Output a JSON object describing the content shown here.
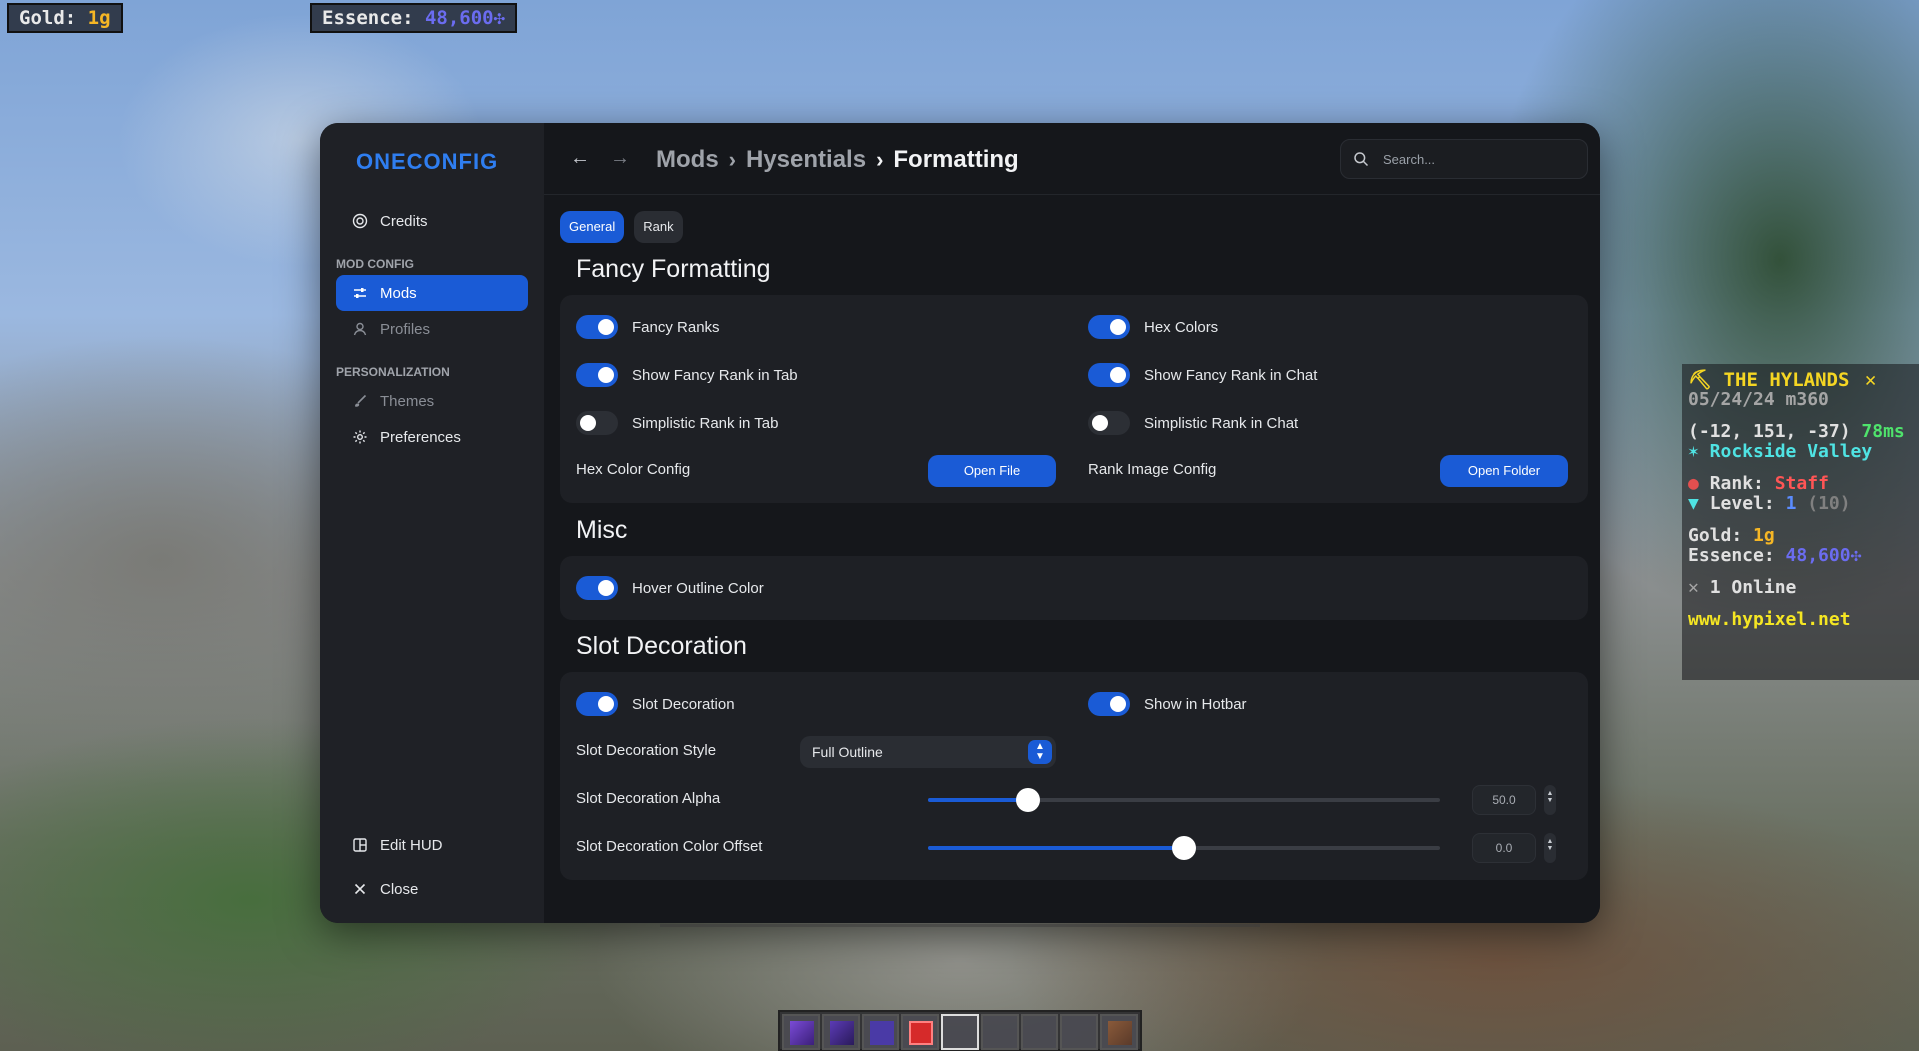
{
  "hud": {
    "gold_label": "Gold:",
    "gold_value": "1g",
    "essence_label": "Essence:",
    "essence_value": "48,600✣"
  },
  "app": {
    "logo": "ONECONFIG"
  },
  "sidebar": {
    "credits": "Credits",
    "mod_config_heading": "MOD CONFIG",
    "mods": "Mods",
    "profiles": "Profiles",
    "personalization_heading": "PERSONALIZATION",
    "themes": "Themes",
    "preferences": "Preferences",
    "edit_hud": "Edit HUD",
    "close": "Close"
  },
  "topbar": {
    "back": "←",
    "forward": "→",
    "breadcrumb": [
      "Mods",
      "Hysentials",
      "Formatting"
    ],
    "search_placeholder": "Search..."
  },
  "tabs": [
    "General",
    "Rank"
  ],
  "fancy_formatting": {
    "title": "Fancy Formatting",
    "fancy_ranks": "Fancy Ranks",
    "hex_colors": "Hex Colors",
    "show_fancy_rank_tab": "Show Fancy Rank in Tab",
    "show_fancy_rank_chat": "Show Fancy Rank in Chat",
    "simplistic_rank_tab": "Simplistic Rank in Tab",
    "simplistic_rank_chat": "Simplistic Rank in Chat",
    "hex_color_config": "Hex Color Config",
    "open_file": "Open File",
    "rank_image_config": "Rank Image Config",
    "open_folder": "Open Folder"
  },
  "misc": {
    "title": "Misc",
    "hover_outline_color": "Hover Outline Color"
  },
  "slot_decoration": {
    "title": "Slot Decoration",
    "slot_decoration": "Slot Decoration",
    "show_in_hotbar": "Show in Hotbar",
    "style_label": "Slot Decoration Style",
    "style_value": "Full Outline",
    "alpha_label": "Slot Decoration Alpha",
    "alpha_value": "50.0",
    "alpha_fraction": 0.195,
    "offset_label": "Slot Decoration Color Offset",
    "offset_value": "0.0",
    "offset_fraction": 0.5
  },
  "scoreboard": {
    "title": "⛏ THE HYLANDS",
    "close": "✕",
    "date": "05/24/24 m360",
    "coords": "(-12, 151, -37)",
    "ping": "78ms",
    "location": "✶ Rockside Valley",
    "rank_label": "Rank:",
    "rank_value": "Staff",
    "level_label": "Level:",
    "level_value": "1",
    "level_extra": "(10)",
    "gold_label": "Gold:",
    "gold_value": "1g",
    "essence_label": "Essence:",
    "essence_value": "48,600✣",
    "online": "1 Online",
    "website": "www.hypixel.net"
  },
  "colors": {
    "accent": "#1a5bd6",
    "gold": "#f5b625",
    "essence": "#6b6cf0"
  }
}
